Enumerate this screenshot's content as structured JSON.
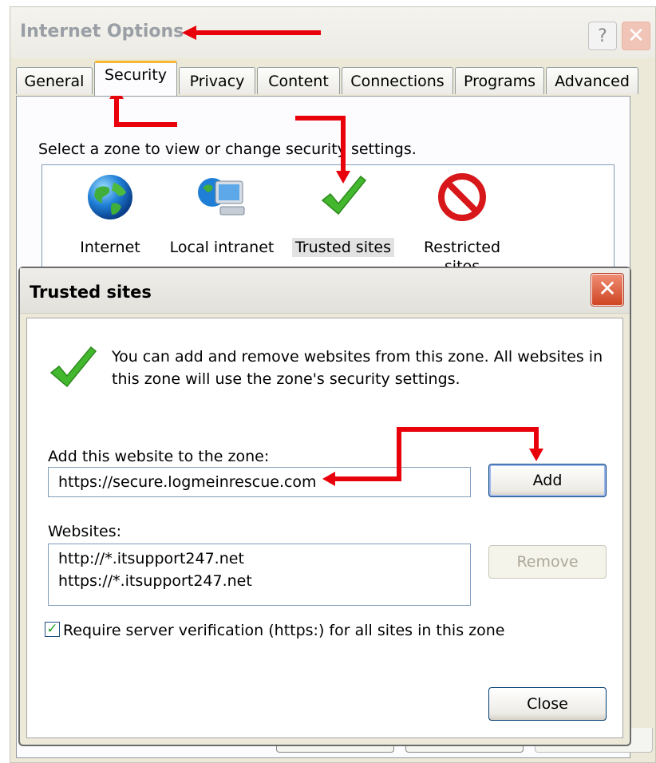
{
  "parent_window": {
    "title": "Internet Options",
    "help_label": "?",
    "close_label": "✕",
    "tabs": [
      {
        "label": "General"
      },
      {
        "label": "Security",
        "active": true
      },
      {
        "label": "Privacy"
      },
      {
        "label": "Content"
      },
      {
        "label": "Connections"
      },
      {
        "label": "Programs"
      },
      {
        "label": "Advanced"
      }
    ],
    "zone_prompt": "Select a zone to view or change security settings.",
    "zones": [
      {
        "label": "Internet",
        "icon": "globe-icon"
      },
      {
        "label": "Local intranet",
        "icon": "intranet-icon"
      },
      {
        "label": "Trusted sites",
        "icon": "checkmark-icon",
        "selected": true
      },
      {
        "label": "Restricted sites",
        "icon": "restricted-icon"
      }
    ]
  },
  "dialog": {
    "title": "Trusted sites",
    "close_label": "✕",
    "description": "You can add and remove websites from this zone. All websites in this zone will use the zone's security settings.",
    "add_label": "Add this website to the zone:",
    "url_value": "https://secure.logmeinrescue.com",
    "add_button": "Add",
    "websites_label": "Websites:",
    "websites": [
      "http://*.itsupport247.net",
      "https://*.itsupport247.net"
    ],
    "remove_button": "Remove",
    "require_verification_label": "Require server verification (https:) for all sites in this zone",
    "require_verification_checked": true,
    "checkbox_mark": "✓",
    "close_button": "Close"
  },
  "colors": {
    "annotation_arrow": "#e8000b",
    "active_tab_accent": "#f7b933",
    "dialog_close": "#cf4523"
  }
}
